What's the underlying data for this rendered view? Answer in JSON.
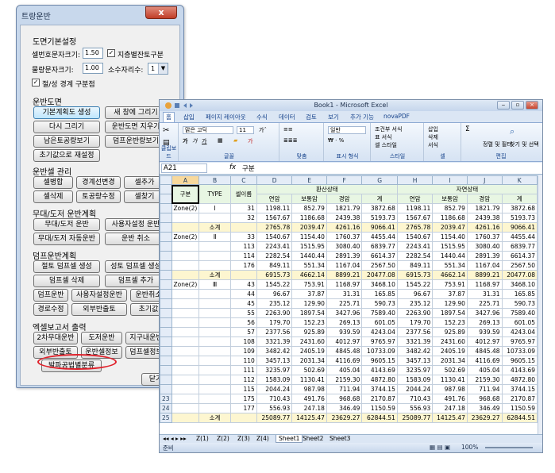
{
  "dialog": {
    "title": "트랑운반",
    "close_label": "x",
    "sec_drawing_base": "도면기본설정",
    "cell_label_size_label": "셀번호문자크기:",
    "cell_label_size_value": "1.50",
    "group_mark_label": "지층별잔토구분",
    "volume_text_size_label": "물량문자크기:",
    "volume_text_size_value": "1.00",
    "decimal_places_label": "소수자리수:",
    "decimal_places_value": "1",
    "cut_fill_border_label": "절/성 경계 구분점",
    "sec_haul_drawing": "운반도면",
    "btn_basic_generate": "기본계획도 생성",
    "btn_new_window_draw": "새 창에 그리기",
    "btn_redraw": "다시 그리기",
    "btn_clear_haul": "운반도면 지우기",
    "btn_remaining_soil": "남은토공량보기",
    "btn_fill_haul_view": "덤프운반량보기",
    "btn_reset_initial": "초기값으로 재설정",
    "sec_cell_manage": "운반셀 관리",
    "btn_cell_split": "셀병합",
    "btn_boundary_edit": "경계선변경",
    "btn_cell_add": "셀추가",
    "btn_cell_delete": "셀삭제",
    "btn_volume_edit": "토공량수정",
    "btn_cell_find": "셀찾기",
    "sec_freeform": "무대/도저 운반계획",
    "btn_freeform_haul": "무대/도저 운반",
    "btn_user_haul": "사용자설정 운반",
    "btn_freeform_auto": "무대/도저 자동운반",
    "btn_cancel_haul": "운반 취소",
    "sec_dump": "덤프운반계획",
    "btn_cut_dump_cell": "절토 덤프셀 생성",
    "btn_fill_dump_cell": "성토 덤프셀 생성",
    "btn_dump_cell_delete": "덤프셀 삭제",
    "btn_dump_cell_add": "덤프셀 추가",
    "btn_dump_haul": "덤프운반",
    "btn_user_set_haul": "사용자설정운반",
    "btn_haul_cancel": "운반취소",
    "btn_route_edit": "경로수정",
    "btn_outside_haul": "외부반출토",
    "btn_initial": "초기값",
    "sec_excel": "엑셀보고서 출력",
    "btn_secondary_haul": "2차무대운반",
    "btn_dozer_haul": "도저운반",
    "btn_district_haul": "지구내운반",
    "btn_outside_out": "외부반출토",
    "btn_haul_cell_info": "운반셀정보",
    "btn_dump_cell_info": "덤프셀정보",
    "btn_blasting_class": "발파공법별분류",
    "btn_close": "닫기"
  },
  "excel": {
    "title": "Book1 - Microsoft Excel",
    "tabs": [
      "홈",
      "삽입",
      "페이지 레이아웃",
      "수식",
      "데이터",
      "검토",
      "보기",
      "추가 기능",
      "novaPDF"
    ],
    "ribbon": {
      "font_name": "맑은 고딕",
      "font_size": "11",
      "number_format": "일반",
      "groups": [
        "클립보드",
        "글꼴",
        "맞춤",
        "표시 형식",
        "스타일",
        "셀",
        "편집"
      ],
      "styles": [
        "조건부 서식",
        "표 서식",
        "셀 스타일"
      ],
      "cells": [
        "삽입",
        "삭제",
        "서식"
      ],
      "edit": [
        "정렬 및 필터",
        "찾기 및 선택"
      ]
    },
    "name_box": "A21",
    "formula": "구분",
    "columns": [
      "A",
      "B",
      "C",
      "D",
      "E",
      "F",
      "G",
      "H",
      "I",
      "J",
      "K"
    ],
    "header1": {
      "gubun": "구분",
      "type": "TYPE",
      "cell_no": "셀이름",
      "haul_state": "환산상태",
      "natural_state": "자연상태"
    },
    "header2": [
      "연암",
      "보통암",
      "경암",
      "계",
      "연암",
      "보통암",
      "경암",
      "계"
    ],
    "rows": [
      {
        "r": "",
        "a": "Zone(2)",
        "b": "Ⅰ",
        "c": "31",
        "v": [
          "1198.11",
          "852.79",
          "1821.79",
          "3872.68",
          "1198.11",
          "852.79",
          "1821.79",
          "3872.68"
        ],
        "sub": false
      },
      {
        "r": "",
        "a": "",
        "b": "",
        "c": "32",
        "v": [
          "1567.67",
          "1186.68",
          "2439.38",
          "5193.73",
          "1567.67",
          "1186.68",
          "2439.38",
          "5193.73"
        ],
        "sub": false
      },
      {
        "r": "",
        "a": "",
        "b": "소계",
        "c": "",
        "v": [
          "2765.78",
          "2039.47",
          "4261.16",
          "9066.41",
          "2765.78",
          "2039.47",
          "4261.16",
          "9066.41"
        ],
        "sub": true
      },
      {
        "r": "",
        "a": "Zone(2)",
        "b": "Ⅱ",
        "c": "33",
        "v": [
          "1540.67",
          "1154.40",
          "1760.37",
          "4455.44",
          "1540.67",
          "1154.40",
          "1760.37",
          "4455.44"
        ],
        "sub": false
      },
      {
        "r": "",
        "a": "",
        "b": "",
        "c": "113",
        "v": [
          "2243.41",
          "1515.95",
          "3080.40",
          "6839.77",
          "2243.41",
          "1515.95",
          "3080.40",
          "6839.77"
        ],
        "sub": false
      },
      {
        "r": "",
        "a": "",
        "b": "",
        "c": "114",
        "v": [
          "2282.54",
          "1440.44",
          "2891.39",
          "6614.37",
          "2282.54",
          "1440.44",
          "2891.39",
          "6614.37"
        ],
        "sub": false
      },
      {
        "r": "",
        "a": "",
        "b": "",
        "c": "176",
        "v": [
          "849.11",
          "551.34",
          "1167.04",
          "2567.50",
          "849.11",
          "551.34",
          "1167.04",
          "2567.50"
        ],
        "sub": false
      },
      {
        "r": "",
        "a": "",
        "b": "소계",
        "c": "",
        "v": [
          "6915.73",
          "4662.14",
          "8899.21",
          "20477.08",
          "6915.73",
          "4662.14",
          "8899.21",
          "20477.08"
        ],
        "sub": true
      },
      {
        "r": "",
        "a": "Zone(2)",
        "b": "Ⅲ",
        "c": "43",
        "v": [
          "1545.22",
          "753.91",
          "1168.97",
          "3468.10",
          "1545.22",
          "753.91",
          "1168.97",
          "3468.10"
        ],
        "sub": false
      },
      {
        "r": "",
        "a": "",
        "b": "",
        "c": "44",
        "v": [
          "96.67",
          "37.87",
          "31.31",
          "165.85",
          "96.67",
          "37.87",
          "31.31",
          "165.85"
        ],
        "sub": false
      },
      {
        "r": "",
        "a": "",
        "b": "",
        "c": "45",
        "v": [
          "235.12",
          "129.90",
          "225.71",
          "590.73",
          "235.12",
          "129.90",
          "225.71",
          "590.73"
        ],
        "sub": false
      },
      {
        "r": "",
        "a": "",
        "b": "",
        "c": "55",
        "v": [
          "2263.90",
          "1897.54",
          "3427.96",
          "7589.40",
          "2263.90",
          "1897.54",
          "3427.96",
          "7589.40"
        ],
        "sub": false
      },
      {
        "r": "",
        "a": "",
        "b": "",
        "c": "56",
        "v": [
          "179.70",
          "152.23",
          "269.13",
          "601.05",
          "179.70",
          "152.23",
          "269.13",
          "601.05"
        ],
        "sub": false
      },
      {
        "r": "",
        "a": "",
        "b": "",
        "c": "57",
        "v": [
          "2377.56",
          "925.89",
          "939.59",
          "4243.04",
          "2377.56",
          "925.89",
          "939.59",
          "4243.04"
        ],
        "sub": false
      },
      {
        "r": "",
        "a": "",
        "b": "",
        "c": "108",
        "v": [
          "3321.39",
          "2431.60",
          "4012.97",
          "9765.97",
          "3321.39",
          "2431.60",
          "4012.97",
          "9765.97"
        ],
        "sub": false
      },
      {
        "r": "",
        "a": "",
        "b": "",
        "c": "109",
        "v": [
          "3482.42",
          "2405.19",
          "4845.48",
          "10733.09",
          "3482.42",
          "2405.19",
          "4845.48",
          "10733.09"
        ],
        "sub": false
      },
      {
        "r": "",
        "a": "",
        "b": "",
        "c": "110",
        "v": [
          "3457.13",
          "2031.34",
          "4116.69",
          "9605.15",
          "3457.13",
          "2031.34",
          "4116.69",
          "9605.15"
        ],
        "sub": false
      },
      {
        "r": "",
        "a": "",
        "b": "",
        "c": "111",
        "v": [
          "3235.97",
          "502.69",
          "405.04",
          "4143.69",
          "3235.97",
          "502.69",
          "405.04",
          "4143.69"
        ],
        "sub": false
      },
      {
        "r": "",
        "a": "",
        "b": "",
        "c": "112",
        "v": [
          "1583.09",
          "1130.41",
          "2159.30",
          "4872.80",
          "1583.09",
          "1130.41",
          "2159.30",
          "4872.80"
        ],
        "sub": false
      },
      {
        "r": "",
        "a": "",
        "b": "",
        "c": "115",
        "v": [
          "2044.24",
          "987.98",
          "711.94",
          "3744.15",
          "2044.24",
          "987.98",
          "711.94",
          "3744.15"
        ],
        "sub": false
      },
      {
        "r": "23",
        "a": "",
        "b": "",
        "c": "175",
        "v": [
          "710.43",
          "491.76",
          "968.68",
          "2170.87",
          "710.43",
          "491.76",
          "968.68",
          "2170.87"
        ],
        "sub": false
      },
      {
        "r": "24",
        "a": "",
        "b": "",
        "c": "177",
        "v": [
          "556.93",
          "247.18",
          "346.49",
          "1150.59",
          "556.93",
          "247.18",
          "346.49",
          "1150.59"
        ],
        "sub": false
      },
      {
        "r": "25",
        "a": "",
        "b": "소계",
        "c": "",
        "v": [
          "25089.77",
          "14125.47",
          "23629.27",
          "62844.51",
          "25089.77",
          "14125.47",
          "23629.27",
          "62844.51"
        ],
        "sub": true
      }
    ],
    "sheet_tabs": [
      "Z(1)",
      "Z(2)",
      "Z(3)",
      "Z(4)",
      "Sheet1",
      "Sheet2",
      "Sheet3"
    ],
    "status_text": "준비",
    "zoom": "100%"
  }
}
